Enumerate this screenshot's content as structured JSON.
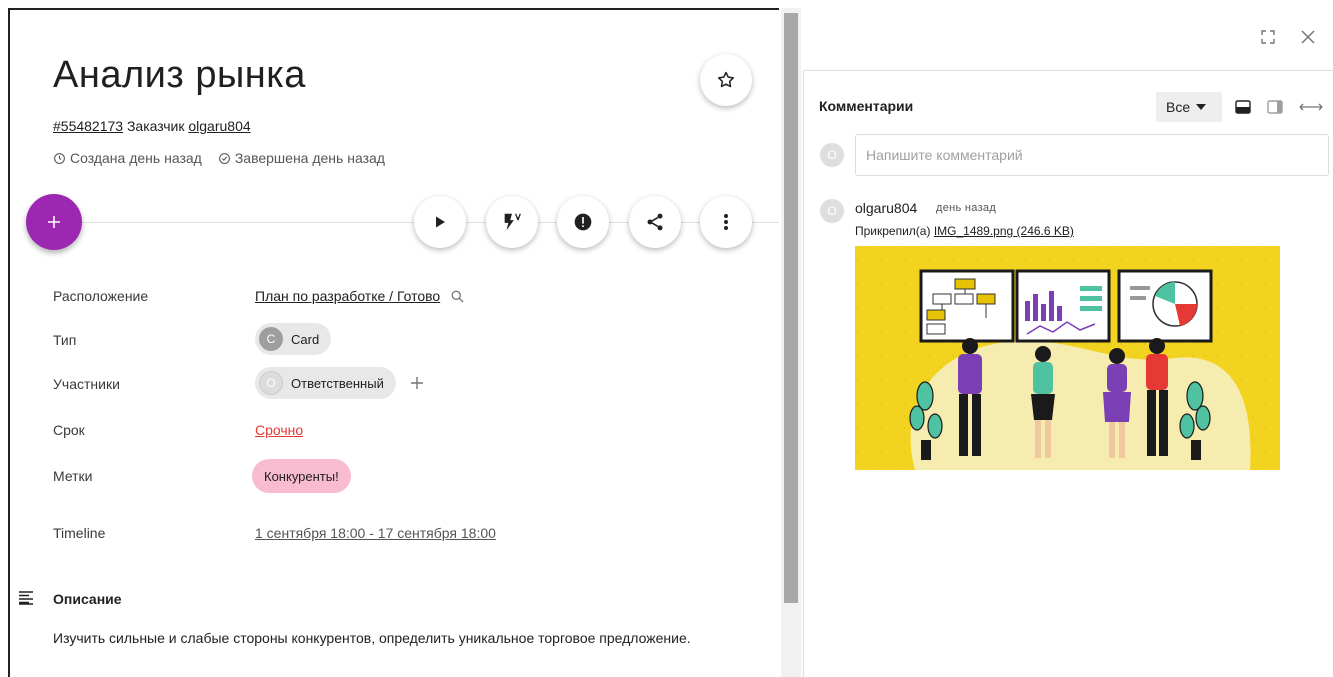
{
  "card": {
    "title": "Анализ рынка",
    "id_link": "#55482173",
    "customer_label": "Заказчик",
    "customer_name": "olgaru804",
    "created": "Создана день назад",
    "completed": "Завершена день назад"
  },
  "properties": {
    "location_label": "Расположение",
    "location_value": "План по разработке / Готово",
    "type_label": "Тип",
    "type_avatar": "C",
    "type_value": "Card",
    "members_label": "Участники",
    "members_avatar": "O",
    "members_value": "Ответственный",
    "due_label": "Срок",
    "due_value": "Срочно",
    "tags_label": "Метки",
    "tag_value": "Конкуренты!",
    "timeline_label": "Timeline",
    "timeline_value": "1 сентября 18:00 - 17 сентября 18:00"
  },
  "description": {
    "title": "Описание",
    "text": "Изучить сильные и слабые стороны конкурентов, определить уникальное торговое предложение."
  },
  "comments": {
    "title": "Комментарии",
    "filter_value": "Все",
    "input_avatar": "O",
    "input_placeholder": "Напишите комментарий",
    "items": [
      {
        "avatar": "O",
        "author": "olgaru804",
        "time": "день назад",
        "attach_prefix": "Прикрепил(а)",
        "attach_name": "IMG_1489.png (246.6 KB)"
      }
    ]
  },
  "colors": {
    "fab": "#9c27b0",
    "tag_bg": "#f8bbd0",
    "due_red": "#e53935",
    "image_bg": "#f2d320"
  }
}
